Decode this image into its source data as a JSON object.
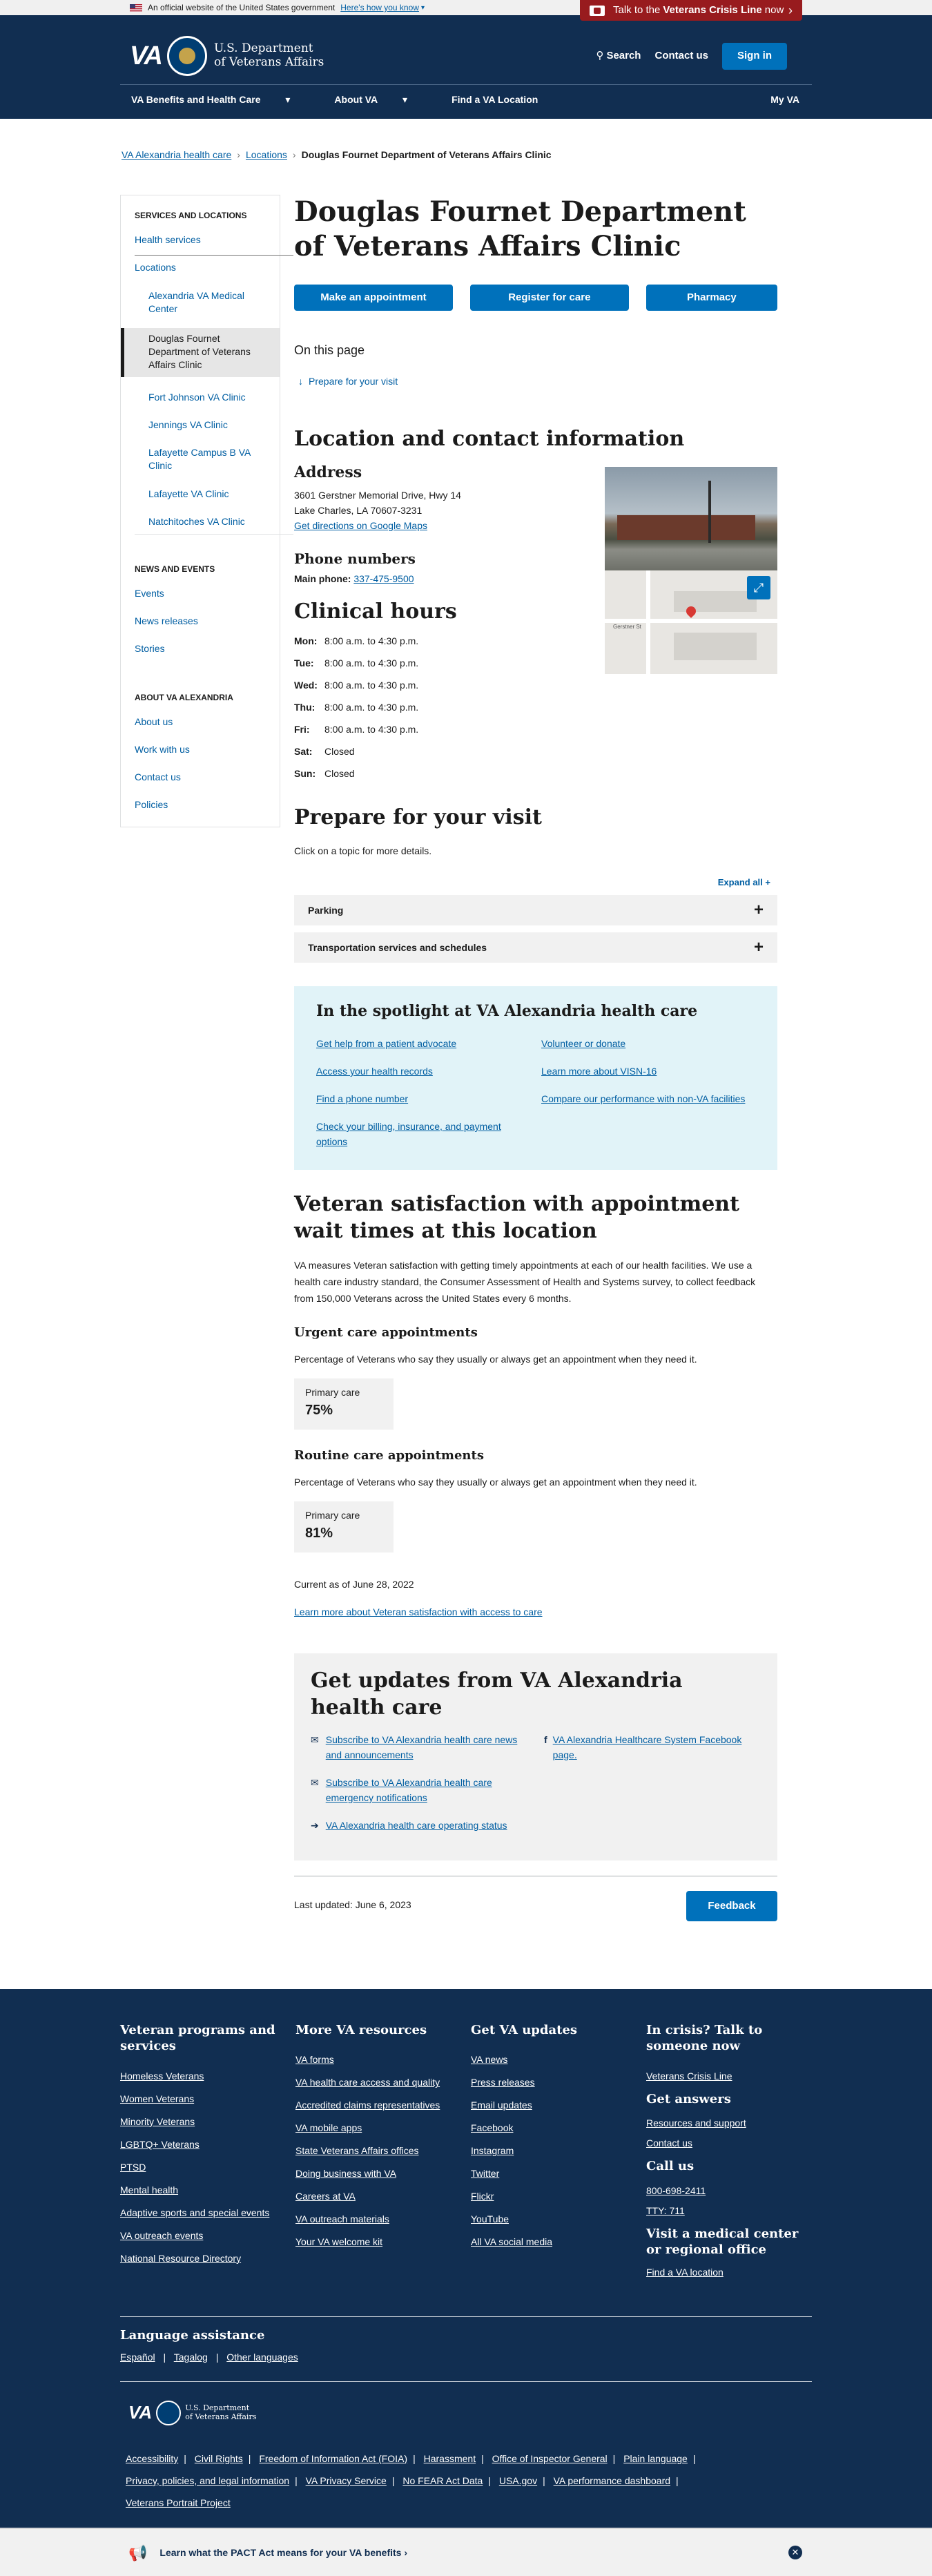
{
  "gov_banner": {
    "text": "An official website of the United States government",
    "link": "Here's how you know"
  },
  "crisis": {
    "pre": "Talk to the",
    "bold": "Veterans Crisis Line",
    "post": "now"
  },
  "header": {
    "logo_text": "VA",
    "dept_line1": "U.S. Department",
    "dept_line2": "of Veterans Affairs",
    "search": "Search",
    "contact": "Contact us",
    "signin": "Sign in",
    "nav": [
      "VA Benefits and Health Care",
      "About VA",
      "Find a VA Location"
    ],
    "myva": "My VA"
  },
  "breadcrumbs": [
    "VA Alexandria health care",
    "Locations",
    "Douglas Fournet Department of Veterans Affairs Clinic"
  ],
  "sidenav": {
    "section1": "Services and Locations",
    "health_services": "Health services",
    "locations": "Locations",
    "location_items": [
      "Alexandria VA Medical Center",
      "Douglas Fournet Department of Veterans Affairs Clinic",
      "Fort Johnson VA Clinic",
      "Jennings VA Clinic",
      "Lafayette Campus B VA Clinic",
      "Lafayette VA Clinic",
      "Natchitoches VA Clinic"
    ],
    "section2": "News and Events",
    "news_items": [
      "Events",
      "News releases",
      "Stories"
    ],
    "section3": "About VA Alexandria",
    "about_items": [
      "About us",
      "Work with us",
      "Contact us",
      "Policies"
    ]
  },
  "main": {
    "title": "Douglas Fournet Department of Veterans Affairs Clinic",
    "buttons": [
      "Make an appointment",
      "Register for care",
      "Pharmacy"
    ],
    "on_this_page": "On this page",
    "otp_link": "Prepare for your visit",
    "location_heading": "Location and contact information",
    "address_heading": "Address",
    "address_line1": "3601 Gerstner Memorial Drive, Hwy 14",
    "address_line2": "Lake Charles, LA 70607-3231",
    "directions": "Get directions on Google Maps",
    "phone_heading": "Phone numbers",
    "main_phone_label": "Main phone:",
    "main_phone": "337-475-9500",
    "hours_heading": "Clinical hours",
    "hours": [
      {
        "day": "Mon:",
        "time": "8:00 a.m. to 4:30 p.m."
      },
      {
        "day": "Tue:",
        "time": "8:00 a.m. to 4:30 p.m."
      },
      {
        "day": "Wed:",
        "time": "8:00 a.m. to 4:30 p.m."
      },
      {
        "day": "Thu:",
        "time": "8:00 a.m. to 4:30 p.m."
      },
      {
        "day": "Fri:",
        "time": "8:00 a.m. to 4:30 p.m."
      },
      {
        "day": "Sat:",
        "time": "Closed"
      },
      {
        "day": "Sun:",
        "time": "Closed"
      }
    ],
    "map_street": "Gerstner St",
    "prepare_heading": "Prepare for your visit",
    "prepare_sub": "Click on a topic for more details.",
    "expand_all": "Expand all +",
    "accordions": [
      "Parking",
      "Transportation services and schedules"
    ],
    "spotlight_heading": "In the spotlight at VA Alexandria health care",
    "spotlight_left": [
      "Get help from a patient advocate",
      "Access your health records",
      "Find a phone number",
      "Check your billing, insurance, and payment options"
    ],
    "spotlight_right": [
      "Volunteer or donate",
      "Learn more about VISN-16",
      "Compare our performance with non-VA facilities"
    ],
    "satisfaction_heading": "Veteran satisfaction with appointment wait times at this location",
    "satisfaction_body": "VA measures Veteran satisfaction with getting timely appointments at each of our health facilities. We use a health care industry standard, the Consumer Assessment of Health and Systems survey, to collect feedback from 150,000 Veterans across the United States every 6 months.",
    "urgent_heading": "Urgent care appointments",
    "urgent_sub": "Percentage of Veterans who say they usually or always get an appointment when they need it.",
    "urgent_label": "Primary care",
    "urgent_value": "75%",
    "routine_heading": "Routine care appointments",
    "routine_sub": "Percentage of Veterans who say they usually or always get an appointment when they need it.",
    "routine_label": "Primary care",
    "routine_value": "81%",
    "current_as_of": "Current as of June 28, 2022",
    "learn_more": "Learn more about Veteran satisfaction with access to care",
    "updates_heading": "Get updates from VA Alexandria health care",
    "updates_links": [
      "Subscribe to VA Alexandria health care news and announcements",
      "Subscribe to VA Alexandria health care emergency notifications",
      "VA Alexandria health care operating status"
    ],
    "facebook_link": "VA Alexandria Healthcare System Facebook page.",
    "last_updated": "Last updated: June 6, 2023",
    "feedback": "Feedback"
  },
  "footer": {
    "col1_heading": "Veteran programs and services",
    "col1": [
      "Homeless Veterans",
      "Women Veterans",
      "Minority Veterans",
      "LGBTQ+ Veterans",
      "PTSD",
      "Mental health",
      "Adaptive sports and special events",
      "VA outreach events",
      "National Resource Directory"
    ],
    "col2_heading": "More VA resources",
    "col2": [
      "VA forms",
      "VA health care access and quality",
      "Accredited claims representatives",
      "VA mobile apps",
      "State Veterans Affairs offices",
      "Doing business with VA",
      "Careers at VA",
      "VA outreach materials",
      "Your VA welcome kit"
    ],
    "col3_heading": "Get VA updates",
    "col3": [
      "VA news",
      "Press releases",
      "Email updates",
      "Facebook",
      "Instagram",
      "Twitter",
      "Flickr",
      "YouTube",
      "All VA social media"
    ],
    "crisis_heading": "In crisis? Talk to someone now",
    "crisis_link": "Veterans Crisis Line",
    "answers_heading": "Get answers",
    "answers": [
      "Resources and support",
      "Contact us"
    ],
    "call_heading": "Call us",
    "phones": [
      "800-698-2411",
      "TTY: 711"
    ],
    "visit_heading": "Visit a medical center or regional office",
    "visit_link": "Find a VA location",
    "lang_heading": "Language assistance",
    "languages": [
      "Español",
      "Tagalog",
      "Other languages"
    ],
    "bottom_links_row1": [
      "Accessibility",
      "Civil Rights",
      "Freedom of Information Act (FOIA)",
      "Harassment",
      "Office of Inspector General",
      "Plain language"
    ],
    "bottom_links_row2": [
      "Privacy, policies, and legal information",
      "VA Privacy Service",
      "No FEAR Act Data",
      "USA.gov",
      "VA performance dashboard"
    ],
    "bottom_links_row3": [
      "Veterans Portrait Project"
    ]
  },
  "pact": {
    "text": "Learn what the PACT Act means for your VA benefits"
  }
}
